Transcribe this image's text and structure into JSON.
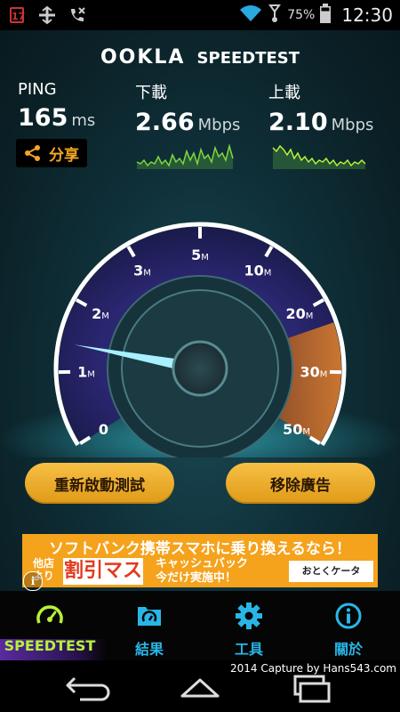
{
  "status_bar": {
    "calendar_day": "17",
    "battery_percent": "75%",
    "time": "12:30",
    "icons": [
      "calendar-icon",
      "network-icon",
      "missed-call-icon",
      "wifi-icon",
      "signal-icon",
      "battery-icon"
    ]
  },
  "brand": {
    "logo": "OOKLA",
    "name": "SPEEDTEST"
  },
  "metrics": {
    "ping": {
      "label": "PING",
      "value": "165",
      "unit": "ms"
    },
    "download": {
      "label": "下載",
      "value": "2.66",
      "unit": "Mbps"
    },
    "upload": {
      "label": "上載",
      "value": "2.10",
      "unit": "Mbps"
    }
  },
  "share": {
    "label": "分享"
  },
  "gauge": {
    "ticks": [
      {
        "num": "0",
        "unit": ""
      },
      {
        "num": "1",
        "unit": "M"
      },
      {
        "num": "2",
        "unit": "M"
      },
      {
        "num": "3",
        "unit": "M"
      },
      {
        "num": "5",
        "unit": "M"
      },
      {
        "num": "10",
        "unit": "M"
      },
      {
        "num": "20",
        "unit": "M"
      },
      {
        "num": "30",
        "unit": "M"
      },
      {
        "num": "50",
        "unit": "M"
      }
    ],
    "needle_value_mbps": 1.4,
    "colors": {
      "ring": "#ffffff",
      "purple": "#6a3fc0",
      "orange": "#e8852a",
      "needle": "#7fe6f5"
    }
  },
  "buttons": {
    "retest": "重新啟動測試",
    "remove_ads": "移除廣告"
  },
  "ad": {
    "line1": "ソフトバンク携帯スマホに乗り換えるなら！",
    "tenpo": "他店より",
    "kanji": "割引マス",
    "line2a": "キャッシュバック",
    "line2b": "今だけ実施中！",
    "logo": "おとくケータイ.net",
    "info": "i"
  },
  "tabs": [
    {
      "label": "SPEEDTEST",
      "icon": "speedometer-icon",
      "active": true
    },
    {
      "label": "結果",
      "icon": "results-folder-icon",
      "active": false
    },
    {
      "label": "工具",
      "icon": "gear-icon",
      "active": false
    },
    {
      "label": "關於",
      "icon": "info-icon",
      "active": false
    }
  ],
  "capture_credit": "2014 Capture by Hans543.com",
  "colors": {
    "accent_blue": "#29b6e6",
    "accent_green": "#b6f23a",
    "button_gold": "#f0ae2e",
    "share_orange": "#f5a623"
  }
}
